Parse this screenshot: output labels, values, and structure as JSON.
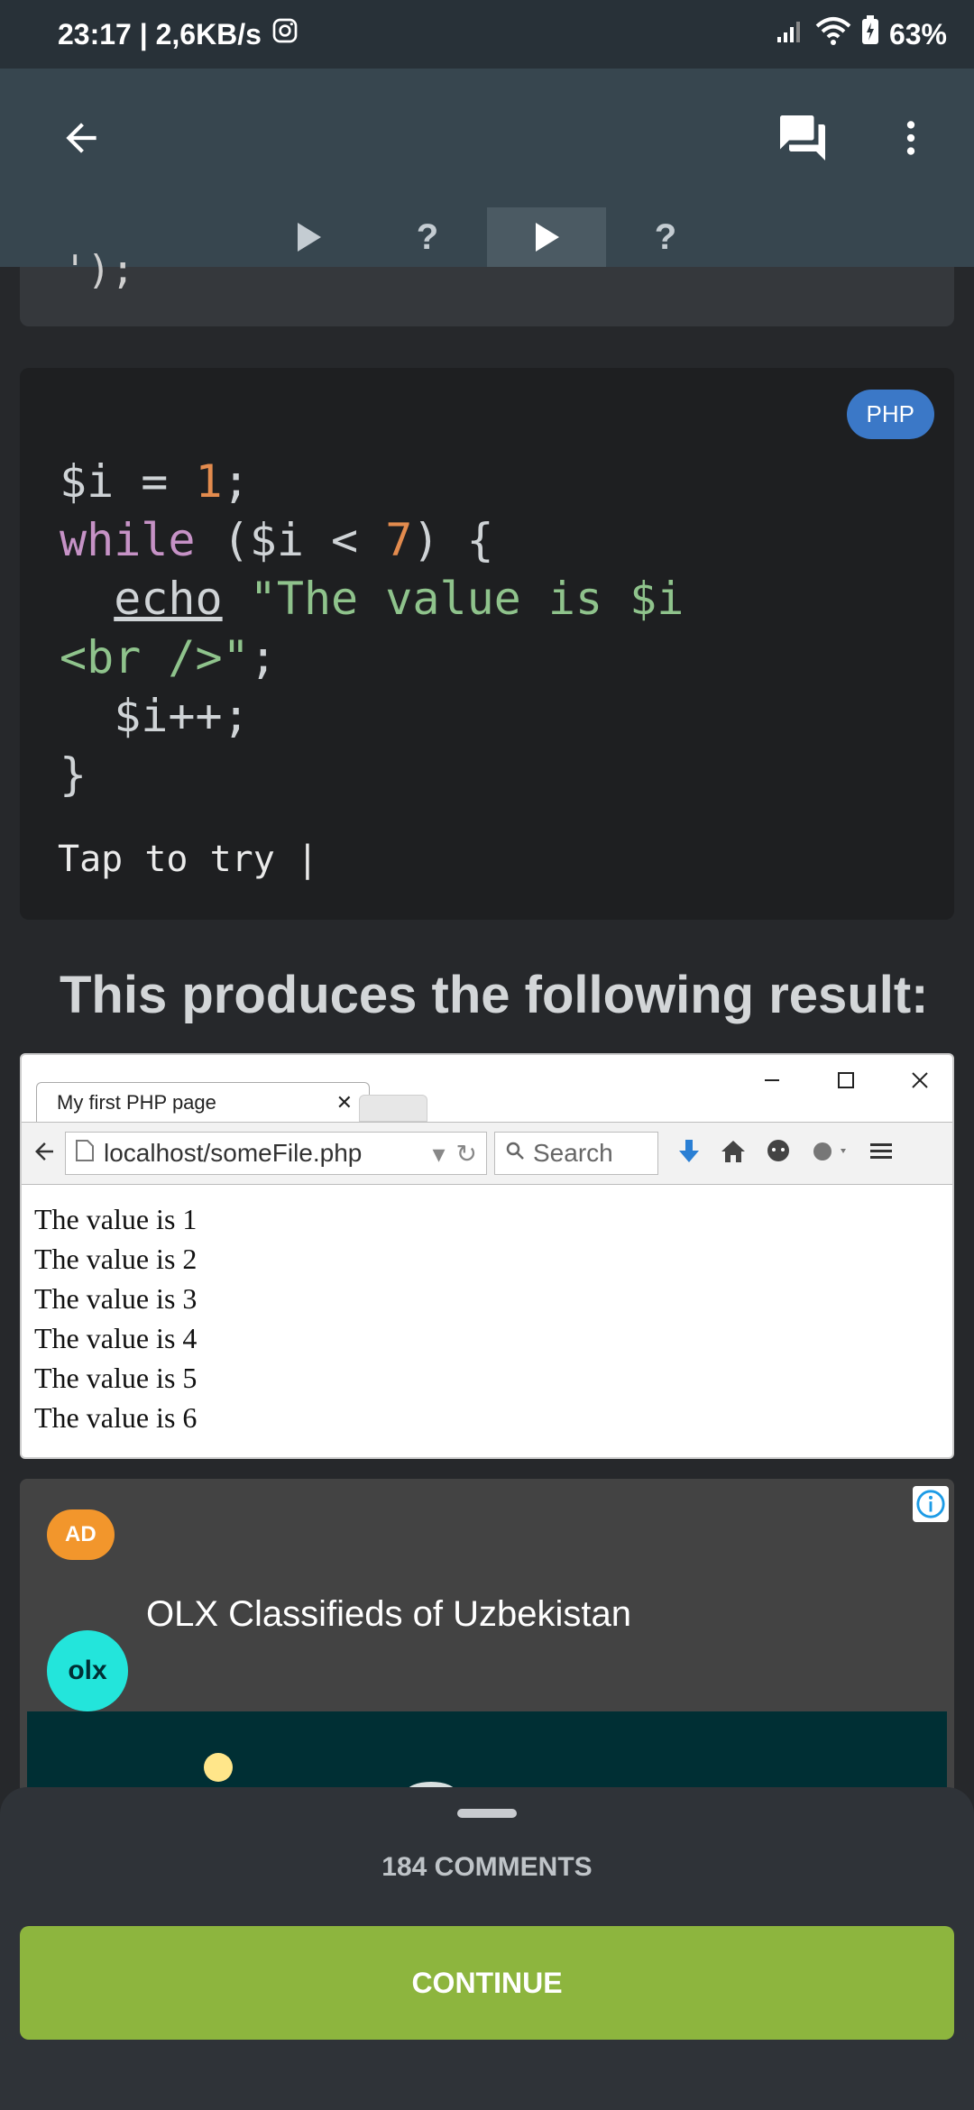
{
  "status_bar": {
    "time_speed": "23:17 | 2,6KB/s",
    "battery": "63%"
  },
  "app_bar": {
    "back_icon": "arrow-left-icon",
    "comments_icon": "chat-bubbles-icon",
    "menu_icon": "more-vert-icon"
  },
  "lesson_tabs": [
    {
      "label": "▶",
      "state": "done"
    },
    {
      "label": "?",
      "state": "quiz"
    },
    {
      "label": "▶",
      "state": "active"
    },
    {
      "label": "?",
      "state": "quiz"
    }
  ],
  "code_block": {
    "language": "PHP",
    "tap_hint": "Tap to try |",
    "lines": [
      "$i = 1;",
      "while ($i < 7) {",
      "  echo \"The value is $i",
      "<br />\";",
      "  $i++;",
      "}"
    ]
  },
  "result_heading": "This produces the following result:",
  "browser": {
    "tab_title": "My first PHP page",
    "url": "localhost/someFile.php",
    "search_placeholder": "Search",
    "output_lines": [
      "The value is 1",
      "The value is 2",
      "The value is 3",
      "The value is 4",
      "The value is 5",
      "The value is 6"
    ]
  },
  "ad": {
    "badge": "AD",
    "logo_text": "olx",
    "title": "OLX Classifieds of Uzbekistan"
  },
  "bottom_sheet": {
    "comments": "184 COMMENTS",
    "continue_label": "CONTINUE"
  },
  "colors": {
    "accent_green": "#8db53e",
    "php_badge": "#3b78c7",
    "ad_badge": "#f2962c"
  }
}
